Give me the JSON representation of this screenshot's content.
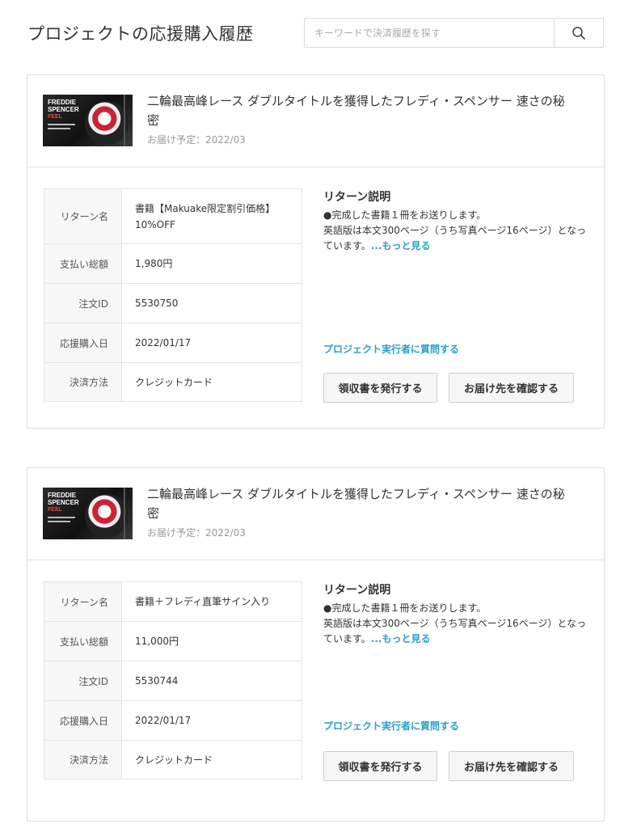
{
  "page_title": "プロジェクトの応援購入履歴",
  "search": {
    "placeholder": "キーワードで決済履歴を探す"
  },
  "colors": {
    "link": "#2aa0c8",
    "border": "#dcdcdc",
    "label_bg": "#f7f7f7"
  },
  "orders": [
    {
      "project_title": "二輪最高峰レース ダブルタイトルを獲得したフレディ・スペンサー 速さの秘密",
      "delivery": "お届け予定：2022/03",
      "thumb_text_1": "FREDDIE SPENCER",
      "thumb_text_2": "FEEL",
      "rows": [
        {
          "label": "リターン名",
          "value": "書籍【Makuake限定割引価格】10%OFF"
        },
        {
          "label": "支払い総額",
          "value": "1,980円"
        },
        {
          "label": "注文ID",
          "value": "5530750"
        },
        {
          "label": "応援購入日",
          "value": "2022/01/17"
        },
        {
          "label": "決済方法",
          "value": "クレジットカード"
        }
      ],
      "return_desc_title": "リターン説明",
      "return_desc_line1": "●完成した書籍１冊をお送りします。",
      "return_desc_line2": "英語版は本文300ページ（うち写真ページ16ページ）となっています。",
      "more_label": "...もっと見る",
      "ask_label": "プロジェクト実行者に質問する",
      "receipt_button": "領収書を発行する",
      "address_button": "お届け先を確認する"
    },
    {
      "project_title": "二輪最高峰レース ダブルタイトルを獲得したフレディ・スペンサー 速さの秘密",
      "delivery": "お届け予定：2022/03",
      "thumb_text_1": "FREDDIE SPENCER",
      "thumb_text_2": "FEEL",
      "rows": [
        {
          "label": "リターン名",
          "value": "書籍＋フレディ直筆サイン入り"
        },
        {
          "label": "支払い総額",
          "value": "11,000円"
        },
        {
          "label": "注文ID",
          "value": "5530744"
        },
        {
          "label": "応援購入日",
          "value": "2022/01/17"
        },
        {
          "label": "決済方法",
          "value": "クレジットカード"
        }
      ],
      "return_desc_title": "リターン説明",
      "return_desc_line1": "●完成した書籍１冊をお送りします。",
      "return_desc_line2": "英語版は本文300ページ（うち写真ページ16ページ）となっています。",
      "more_label": "...もっと見る",
      "ask_label": "プロジェクト実行者に質問する",
      "receipt_button": "領収書を発行する",
      "address_button": "お届け先を確認する"
    }
  ]
}
